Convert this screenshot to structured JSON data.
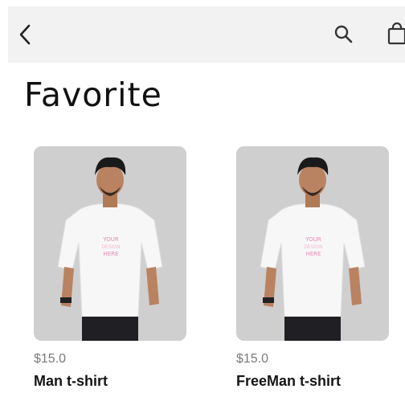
{
  "header": {
    "back_icon": "chevron-left-icon",
    "search_icon": "search-icon",
    "bag_icon": "shopping-bag-icon",
    "background": "#f2f2f2"
  },
  "page": {
    "title": "Favorite"
  },
  "products": [
    {
      "price": "$15.0",
      "name": "Man t-shirt",
      "image": "man-in-white-t-shirt"
    },
    {
      "price": "$15.0",
      "name": "FreeMan t-shirt",
      "image": "man-in-white-t-shirt"
    }
  ]
}
